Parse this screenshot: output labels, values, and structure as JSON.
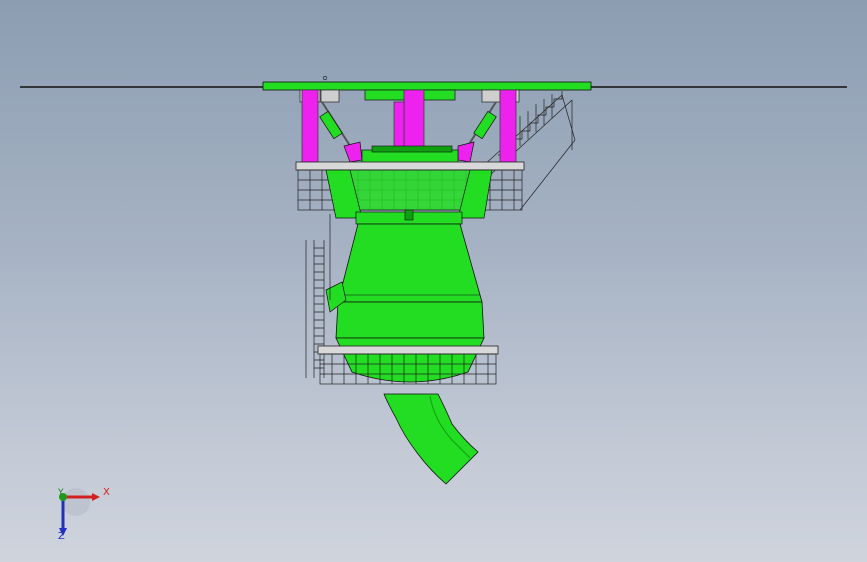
{
  "viewport": {
    "background_top": "#8c9db2",
    "background_bottom": "#cfd4dd"
  },
  "model_colors": {
    "steel_green": "#22dd22",
    "steel_green_dark": "#0f9f0f",
    "column_magenta": "#ee22ee",
    "platform_grey": "#cfcfcf",
    "outline": "#222222"
  },
  "triad": {
    "x_label": "X",
    "y_label": "Y",
    "z_label": "Z",
    "x_color": "#d42020",
    "y_color": "#1f7a1f",
    "z_color": "#2030c0"
  }
}
